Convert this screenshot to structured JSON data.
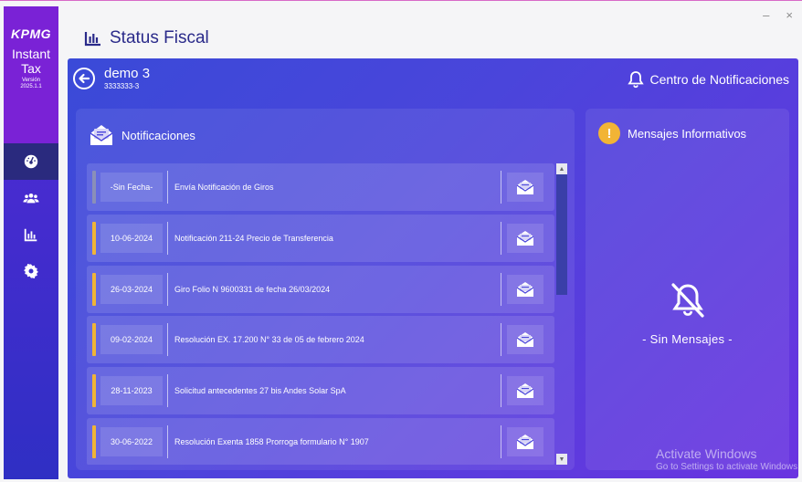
{
  "window": {
    "minimize": "–",
    "close": "×"
  },
  "sidebar": {
    "logo": "KPMG",
    "app_name_1": "Instant",
    "app_name_2": "Tax",
    "version_label": "Versión",
    "version": "2025.1.1",
    "items": [
      {
        "icon": "dashboard-icon"
      },
      {
        "icon": "users-icon"
      },
      {
        "icon": "chart-icon"
      },
      {
        "icon": "gear-icon"
      }
    ]
  },
  "header": {
    "title": "Status Fiscal",
    "icon": "bar-chart-icon"
  },
  "company": {
    "name": "demo 3",
    "rut": "3333333-3"
  },
  "notification_center": {
    "label": "Centro de Notificaciones"
  },
  "notifications": {
    "title": "Notificaciones",
    "rows": [
      {
        "date": "-Sin Fecha-",
        "description": "Envía Notificación de Giros",
        "status_color": "#8a8fb8"
      },
      {
        "date": "10-06-2024",
        "description": "Notificación 211-24 Precio de Transferencia",
        "status_color": "#f0b437"
      },
      {
        "date": "26-03-2024",
        "description": "Giro Folio N 9600331 de fecha 26/03/2024",
        "status_color": "#f0b437"
      },
      {
        "date": "09-02-2024",
        "description": "Resolución EX. 17.200 N° 33 de 05 de febrero 2024",
        "status_color": "#f0b437"
      },
      {
        "date": "28-11-2023",
        "description": "Solicitud antecedentes 27 bis Andes Solar SpA",
        "status_color": "#f0b437"
      },
      {
        "date": "30-06-2022",
        "description": "Resolución Exenta 1858 Prorroga formulario N° 1907",
        "status_color": "#f0b437"
      }
    ]
  },
  "messages": {
    "title": "Mensajes Informativos",
    "warning_symbol": "!",
    "empty_text": "- Sin Mensajes -"
  },
  "watermark": {
    "line1": "Activate Windows",
    "line2": "Go to Settings to activate Windows."
  },
  "colors": {
    "accent": "#f0b437",
    "sidebar": "#4a2bd1",
    "panel": "#4a45db"
  }
}
